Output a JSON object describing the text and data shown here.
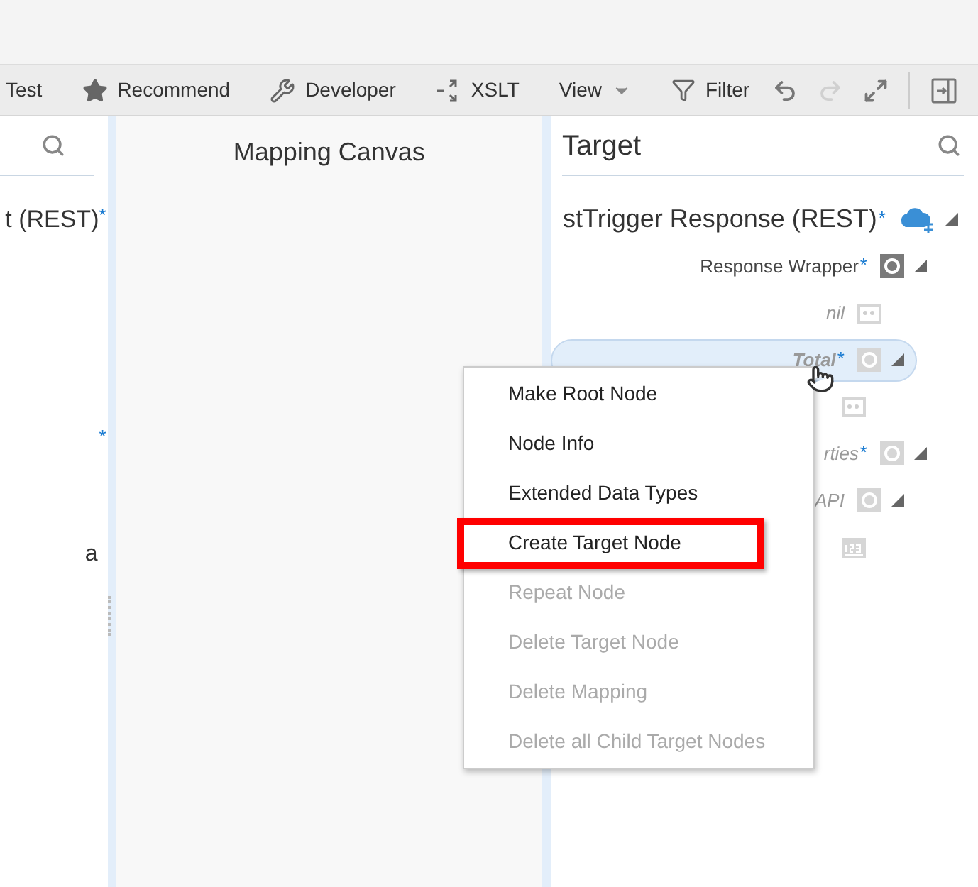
{
  "toolbar": [
    {
      "label": "Test",
      "kind": "plain"
    },
    {
      "label": "Recommend",
      "kind": "star"
    },
    {
      "label": "Developer",
      "kind": "tools"
    },
    {
      "label": "XSLT",
      "kind": "xslt"
    },
    {
      "label": "View",
      "kind": "dropdown"
    },
    {
      "label": "Filter",
      "kind": "filter"
    }
  ],
  "toolbar_actions": [
    {
      "kind": "undo",
      "disabled": false
    },
    {
      "kind": "redo",
      "disabled": true
    },
    {
      "kind": "expand",
      "disabled": false
    },
    {
      "kind": "panel",
      "disabled": false
    }
  ],
  "source": {
    "rows": [
      {
        "label": "t (REST)",
        "asterisk": "*"
      },
      {
        "asterisk": "*"
      },
      {
        "label": "a"
      }
    ]
  },
  "canvas": {
    "title": "Mapping Canvas"
  },
  "target": {
    "title": "Target",
    "tree": {
      "label": "stTrigger Response (REST)",
      "asterisk": "*",
      "selected": false,
      "kind": "rest",
      "children": [
        {
          "label": "Response Wrapper",
          "asterisk": "*",
          "optional": false,
          "selected": false,
          "kind": "wrapper",
          "children": [
            {
              "label": "nil",
              "optional": true,
              "selected": false,
              "kind": "string"
            },
            {
              "label": "Total",
              "asterisk": "*",
              "optional": true,
              "selected": true,
              "kind": "object",
              "children": [
                {
                  "selected": false,
                  "kind": "string"
                }
              ]
            }
          ]
        },
        {
          "label": "rties",
          "asterisk": "*",
          "optional": true,
          "selected": false,
          "kind": "object",
          "children": [
            {
              "label": "API",
              "optional": true,
              "selected": false,
              "kind": "object",
              "children": [
                {
                  "selected": false,
                  "kind": "number"
                }
              ]
            }
          ]
        }
      ]
    }
  },
  "context_menu": [
    {
      "label": "Make Root Node",
      "disabled": false,
      "highlighted": false
    },
    {
      "label": "Node Info",
      "disabled": false,
      "highlighted": false
    },
    {
      "label": "Extended Data Types",
      "disabled": false,
      "highlighted": false
    },
    {
      "label": "Create Target Node",
      "disabled": false,
      "highlighted": true
    },
    {
      "label": "Repeat Node",
      "disabled": true,
      "highlighted": false
    },
    {
      "label": "Delete Target Node",
      "disabled": true,
      "highlighted": false
    },
    {
      "label": "Delete Mapping",
      "disabled": true,
      "highlighted": false
    },
    {
      "label": "Delete all Child Target Nodes",
      "disabled": true,
      "highlighted": false
    }
  ]
}
